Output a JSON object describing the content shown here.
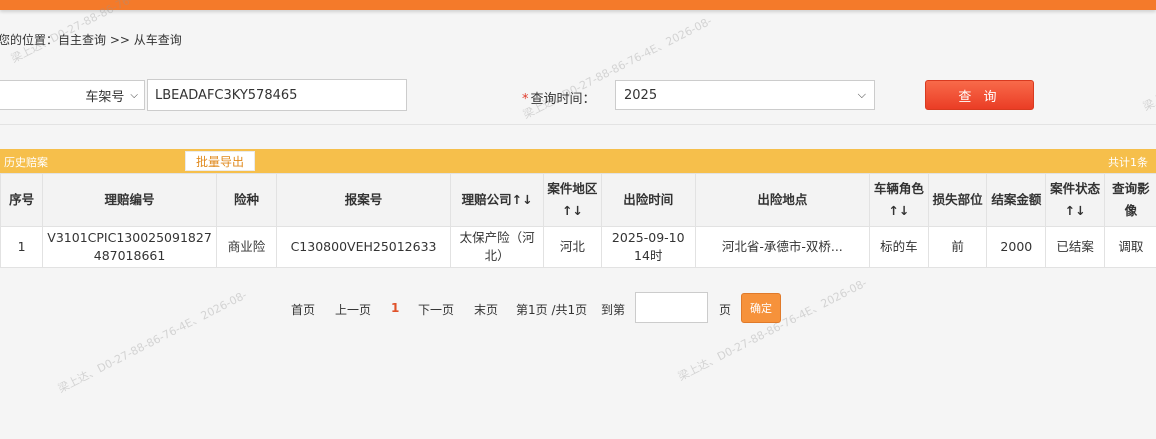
{
  "breadcrumb": "您的位置：自主查询 >> 从车查询",
  "search": {
    "type_value": "车架号",
    "vin_value": "LBEADAFC3KY578465",
    "time_required": "*",
    "time_label": "查询时间：",
    "time_value": "2025",
    "query_label": "查 询"
  },
  "section": {
    "title": "历史赔案",
    "export_label": "批量导出",
    "total": "共计1条"
  },
  "table": {
    "headers": [
      "序号",
      "理赔编号",
      "险种",
      "报案号",
      "理赔公司↑↓",
      "案件地区↑↓",
      "出险时间",
      "出险地点",
      "车辆角色↑↓",
      "损失部位",
      "结案金额",
      "案件状态↑↓",
      "查询影像"
    ],
    "rows": [
      [
        "1",
        "V3101CPIC130025091827487018661",
        "商业险",
        "C130800VEH25012633",
        "太保产险（河北）",
        "河北",
        "2025-09-10 14时",
        "河北省-承德市-双桥...",
        "标的车",
        "前",
        "2000",
        "已结案",
        "调取"
      ]
    ]
  },
  "pager": {
    "first": "首页",
    "prev": "上一页",
    "current": "1",
    "next": "下一页",
    "last": "末页",
    "info": "第1页 /共1页",
    "goto": "到第",
    "page_unit": "页",
    "confirm": "确定"
  },
  "watermark": "梁上达、D0-27-88-86-76-4E、2026-08-"
}
